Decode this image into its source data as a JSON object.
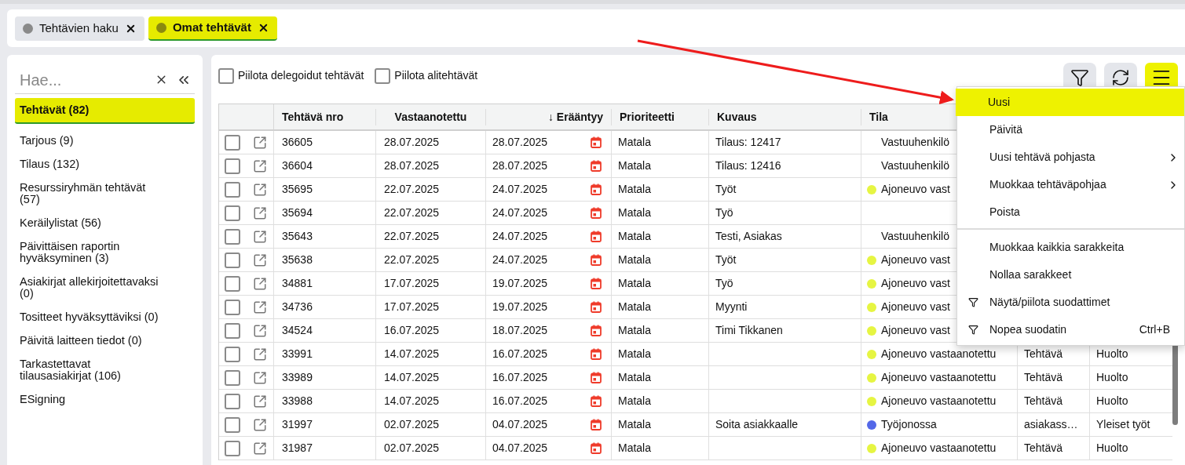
{
  "tabs": [
    {
      "label": "Tehtävien haku",
      "selected": false
    },
    {
      "label": "Omat tehtävät",
      "selected": true
    }
  ],
  "sidebar": {
    "search": {
      "placeholder": "Hae..."
    },
    "items": [
      {
        "label": "Tehtävät (82)",
        "selected": true
      },
      {
        "label": "Tarjous (9)",
        "selected": false
      },
      {
        "label": "Tilaus (132)",
        "selected": false
      },
      {
        "label": "Resurssiryhmän tehtävät (57)",
        "selected": false
      },
      {
        "label": "Keräilylistat (56)",
        "selected": false
      },
      {
        "label": "Päivittäisen raportin hyväksyminen (3)",
        "selected": false
      },
      {
        "label": "Asiakirjat allekirjoitettavaksi (0)",
        "selected": false
      },
      {
        "label": "Tositteet hyväksyttäviksi (0)",
        "selected": false
      },
      {
        "label": "Päivitä laitteen tiedot (0)",
        "selected": false
      },
      {
        "label": "Tarkastettavat tilausasiakirjat (106)",
        "selected": false
      },
      {
        "label": "ESigning",
        "selected": false
      }
    ]
  },
  "filters": [
    {
      "label": "Piilota delegoidut tehtävät",
      "checked": false
    },
    {
      "label": "Piilota alitehtävät",
      "checked": false
    }
  ],
  "toolbar": {
    "menu_open": true
  },
  "table": {
    "columns": [
      "Tehtävä nro",
      "Vastaanotettu",
      "↓ Erääntyy",
      "Prioriteetti",
      "Kuvaus",
      "Tila"
    ],
    "rows": [
      {
        "checked": false,
        "nro": "36605",
        "received": "28.07.2025",
        "due": "28.07.2025",
        "priority": "Matala",
        "description": "Tilaus: 12417",
        "status": "Vastuuhenkilö"
      },
      {
        "checked": false,
        "nro": "36604",
        "received": "28.07.2025",
        "due": "28.07.2025",
        "priority": "Matala",
        "description": "Tilaus: 12416",
        "status": "Vastuuhenkilö"
      },
      {
        "checked": false,
        "nro": "35695",
        "received": "22.07.2025",
        "due": "24.07.2025",
        "priority": "Matala",
        "description": "Työt",
        "status": "Ajoneuvo vast",
        "color": "#e6f542"
      },
      {
        "checked": false,
        "nro": "35694",
        "received": "22.07.2025",
        "due": "24.07.2025",
        "priority": "Matala",
        "description": "Työ"
      },
      {
        "checked": false,
        "nro": "35643",
        "received": "22.07.2025",
        "due": "24.07.2025",
        "priority": "Matala",
        "description": "Testi, Asiakas",
        "status": "Vastuuhenkilö"
      },
      {
        "checked": false,
        "nro": "35638",
        "received": "22.07.2025",
        "due": "24.07.2025",
        "priority": "Matala",
        "description": "Työt",
        "status": "Ajoneuvo vast",
        "color": "#e6f542"
      },
      {
        "checked": false,
        "nro": "34881",
        "received": "17.07.2025",
        "due": "19.07.2025",
        "priority": "Matala",
        "description": "Työ",
        "status": "Ajoneuvo vast",
        "color": "#e6f542"
      },
      {
        "checked": false,
        "nro": "34736",
        "received": "17.07.2025",
        "due": "19.07.2025",
        "priority": "Matala",
        "description": "Myynti",
        "status": "Ajoneuvo vast",
        "color": "#e6f542"
      },
      {
        "checked": false,
        "nro": "34524",
        "received": "16.07.2025",
        "due": "18.07.2025",
        "priority": "Matala",
        "description": "Timi Tikkanen",
        "status": "Ajoneuvo vast",
        "color": "#e6f542"
      },
      {
        "checked": false,
        "nro": "33991",
        "received": "14.07.2025",
        "due": "16.07.2025",
        "priority": "Matala",
        "status": "Ajoneuvo vastaanotettu",
        "color": "#e6f542",
        "column_8": "Tehtävä",
        "column_9": "Huolto"
      },
      {
        "checked": false,
        "nro": "33989",
        "received": "14.07.2025",
        "due": "16.07.2025",
        "priority": "Matala",
        "status": "Ajoneuvo vastaanotettu",
        "color": "#e6f542",
        "column_8": "Tehtävä",
        "column_9": "Huolto"
      },
      {
        "checked": false,
        "nro": "33988",
        "received": "14.07.2025",
        "due": "16.07.2025",
        "priority": "Matala",
        "status": "Ajoneuvo vastaanotettu",
        "color": "#e6f542",
        "column_8": "Tehtävä",
        "column_9": "Huolto"
      },
      {
        "checked": false,
        "nro": "31997",
        "received": "02.07.2025",
        "due": "04.07.2025",
        "priority": "Matala",
        "description": "Soita asiakkaalle",
        "status": "Työjonossa",
        "color": "#5468e8",
        "column_8": "asiakass…",
        "column_9": "Yleiset työt"
      },
      {
        "checked": false,
        "nro": "31987",
        "received": "02.07.2025",
        "due": "04.07.2025",
        "priority": "Matala",
        "status": "Ajoneuvo vastaanotettu",
        "color": "#e6f542",
        "column_8": "Tehtävä",
        "column_9": "Huolto"
      }
    ]
  },
  "menu": {
    "sections": [
      [
        {
          "label": "Uusi",
          "kind": "plain",
          "selected": true
        },
        {
          "label": "Päivitä",
          "kind": "plain",
          "selected": false
        },
        {
          "label": "Uusi tehtävä pohjasta",
          "kind": "submenu",
          "selected": false
        },
        {
          "label": "Muokkaa tehtäväpohjaa",
          "kind": "submenu",
          "selected": false
        },
        {
          "label": "Poista",
          "kind": "plain",
          "selected": false
        }
      ],
      [
        {
          "label": "Muokkaa kaikkia sarakkeita",
          "kind": "plain",
          "selected": false
        },
        {
          "label": "Nollaa sarakkeet",
          "kind": "plain",
          "selected": false
        },
        {
          "label": "Näytä/piilota suodattimet",
          "kind": "filter",
          "selected": false
        },
        {
          "label": "Nopea suodatin",
          "kind": "filter",
          "selected": false,
          "shortcut": "Ctrl+B"
        }
      ]
    ]
  }
}
